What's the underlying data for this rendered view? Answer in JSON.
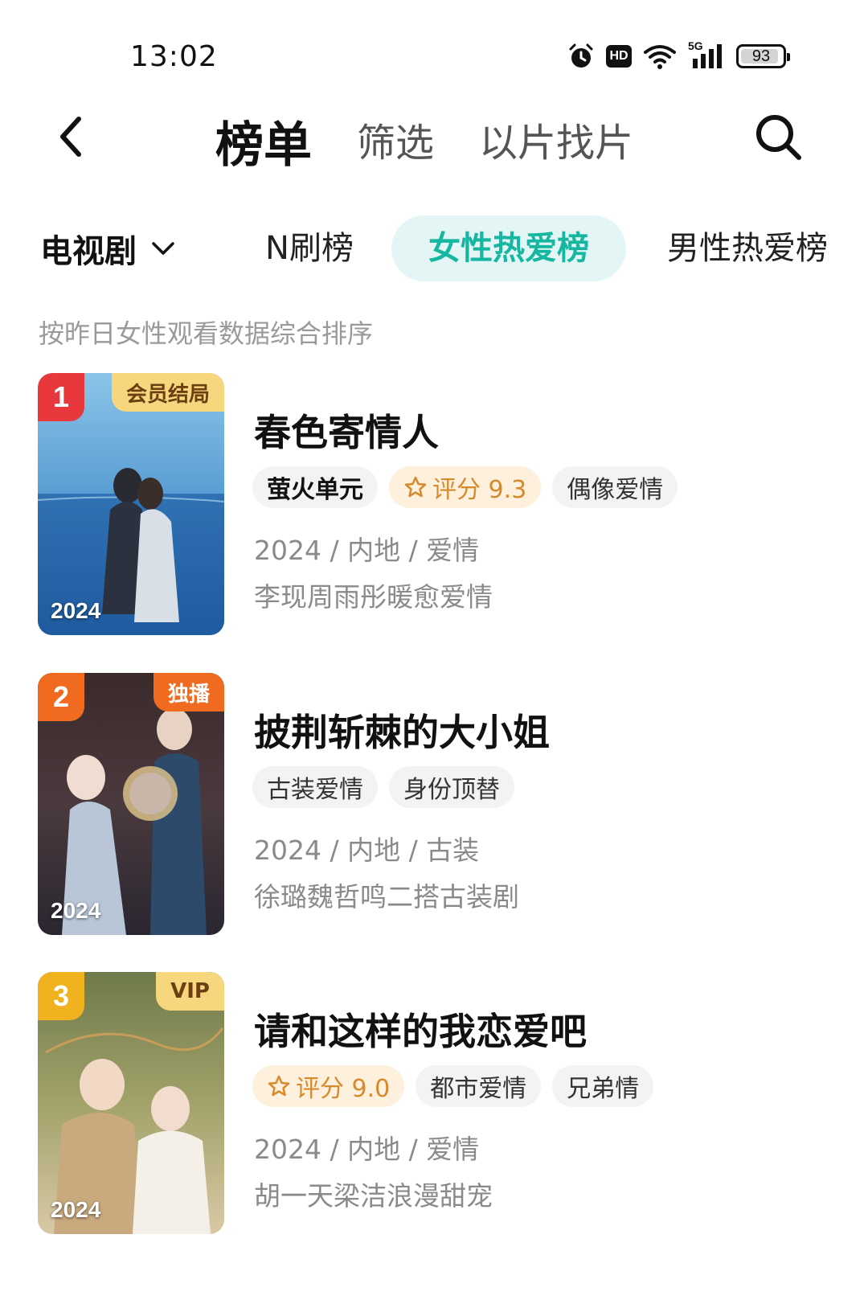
{
  "status_bar": {
    "time": "13:02",
    "battery": "93",
    "battery_level": 0.93,
    "icons": [
      "alarm-icon",
      "hd-icon",
      "wifi-icon",
      "signal-5g-icon",
      "battery-icon"
    ],
    "hd_label": "HD",
    "net_label": "5G"
  },
  "nav": {
    "tabs": [
      {
        "label": "榜单",
        "active": true
      },
      {
        "label": "筛选",
        "active": false
      },
      {
        "label": "以片找片",
        "active": false
      }
    ],
    "back_icon": "chevron-left-icon",
    "search_icon": "search-icon"
  },
  "category": {
    "selected": "电视剧",
    "dropdown_icon": "chevron-down-icon",
    "rank_tabs": [
      {
        "label": "N刷榜",
        "active": false
      },
      {
        "label": "女性热爱榜",
        "active": true
      },
      {
        "label": "男性热爱榜",
        "active": false
      }
    ],
    "accent_color": "#16b7a0"
  },
  "subtitle": "按昨日女性观看数据综合排序",
  "items": [
    {
      "rank": "1",
      "rank_color": "#e8383d",
      "badge": "会员结局",
      "badge_bg": "#f7d77d",
      "badge_color": "#6b3f12",
      "year_label": "2024",
      "title": "春色寄情人",
      "tags": [
        "萤火单元",
        "评分 9.3",
        "偶像爱情"
      ],
      "meta": "2024 / 内地 / 爱情",
      "desc": "李现周雨彤暖愈爱情"
    },
    {
      "rank": "2",
      "rank_color": "#f06a1f",
      "badge": "独播",
      "badge_bg": "#f06a1f",
      "badge_color": "#ffffff",
      "year_label": "2024",
      "title": "披荆斩棘的大小姐",
      "tags": [
        "古装爱情",
        "身份顶替"
      ],
      "meta": "2024 / 内地 / 古装",
      "desc": "徐璐魏哲鸣二搭古装剧"
    },
    {
      "rank": "3",
      "rank_color": "#f0b21e",
      "badge": "VIP",
      "badge_bg": "#f7d77d",
      "badge_color": "#6b3f12",
      "year_label": "2024",
      "title": "请和这样的我恋爱吧",
      "tags": [
        "评分 9.0",
        "都市爱情",
        "兄弟情"
      ],
      "meta": "2024 / 内地 / 爱情",
      "desc": "胡一天梁洁浪漫甜宠"
    }
  ]
}
